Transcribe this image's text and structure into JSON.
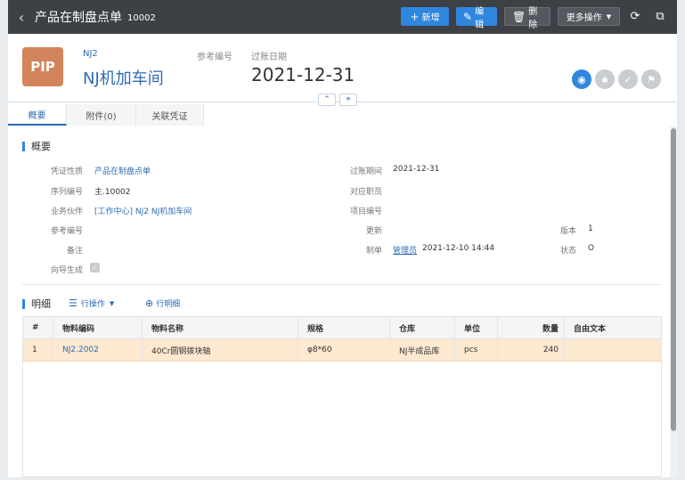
{
  "topbar": {
    "back_icon": "chevron-left-icon",
    "title": "产品在制盘点单",
    "doc_no": "10002",
    "buttons": {
      "new": "新增",
      "edit": "编辑",
      "delete": "删除",
      "more": "更多操作"
    }
  },
  "header": {
    "logo": "PIP",
    "code_small": "NJ2",
    "code_big": "NJ机加车间",
    "ref_label": "参考编号",
    "post_label": "过账日期",
    "post_date": "2021-12-31",
    "status_icons": [
      "circle-dot-icon",
      "lock-icon",
      "check-icon",
      "flag-icon"
    ],
    "accent": "#2e86de"
  },
  "tabs": [
    "概要",
    "附件(0)",
    "关联凭证"
  ],
  "summary": {
    "title": "概要",
    "fields": {
      "voucher_type_label": "凭证性质",
      "voucher_type": "产品在制盘点单",
      "serial_label": "序列编号",
      "serial": "主.10002",
      "partner_label": "业务伙伴",
      "partner": "[工作中心] NJ2 NJ机加车间",
      "ref_label": "参考编号",
      "note_label": "备注",
      "wizard_label": "向导生成",
      "period_label": "过账期间",
      "period": "2021-12-31",
      "staff_label": "对应职员",
      "project_label": "项目编号",
      "update_label": "更新",
      "creator_label": "制单",
      "creator_name": "管理员",
      "creator_time": "2021-12-10 14:44",
      "version_label": "版本",
      "version": "1",
      "state_label": "状态",
      "state": "O"
    }
  },
  "detail": {
    "title": "明细",
    "row_ops": "行操作",
    "add_row": "行明细",
    "columns": [
      "#",
      "物料编码",
      "物料名称",
      "规格",
      "仓库",
      "单位",
      "数量",
      "自由文本"
    ],
    "rows": [
      [
        "1",
        "NJ2.2002",
        "40Cr圆钢拨块轴",
        "φ8*60",
        "NJ半成品库",
        "pcs",
        "240",
        ""
      ]
    ]
  }
}
